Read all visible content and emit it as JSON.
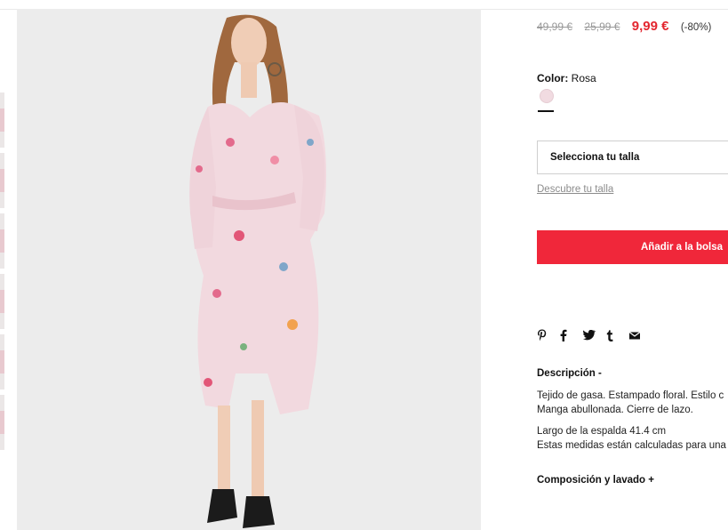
{
  "product": {
    "price_original": "49,99 €",
    "price_previous": "25,99 €",
    "price_current": "9,99 €",
    "discount": "(-80%)"
  },
  "color": {
    "label": "Color:",
    "value": "Rosa",
    "swatch_color": "#f1dbe1"
  },
  "size": {
    "select_label": "Selecciona tu talla",
    "guide_link": "Descubre tu talla"
  },
  "cart": {
    "add_label": "Añadir a la bolsa",
    "accent_color": "#f0273a"
  },
  "share_icons": [
    "pinterest-icon",
    "facebook-icon",
    "twitter-icon",
    "tumblr-icon",
    "mail-icon"
  ],
  "description": {
    "title": "Descripción -",
    "line1": "Tejido de gasa. Estampado floral. Estilo c",
    "line2": "Manga abullonada. Cierre de lazo.",
    "line3": "Largo de la espalda 41.4 cm",
    "line4": "Estas medidas están calculadas para una"
  },
  "composition": {
    "title": "Composición y lavado +"
  }
}
